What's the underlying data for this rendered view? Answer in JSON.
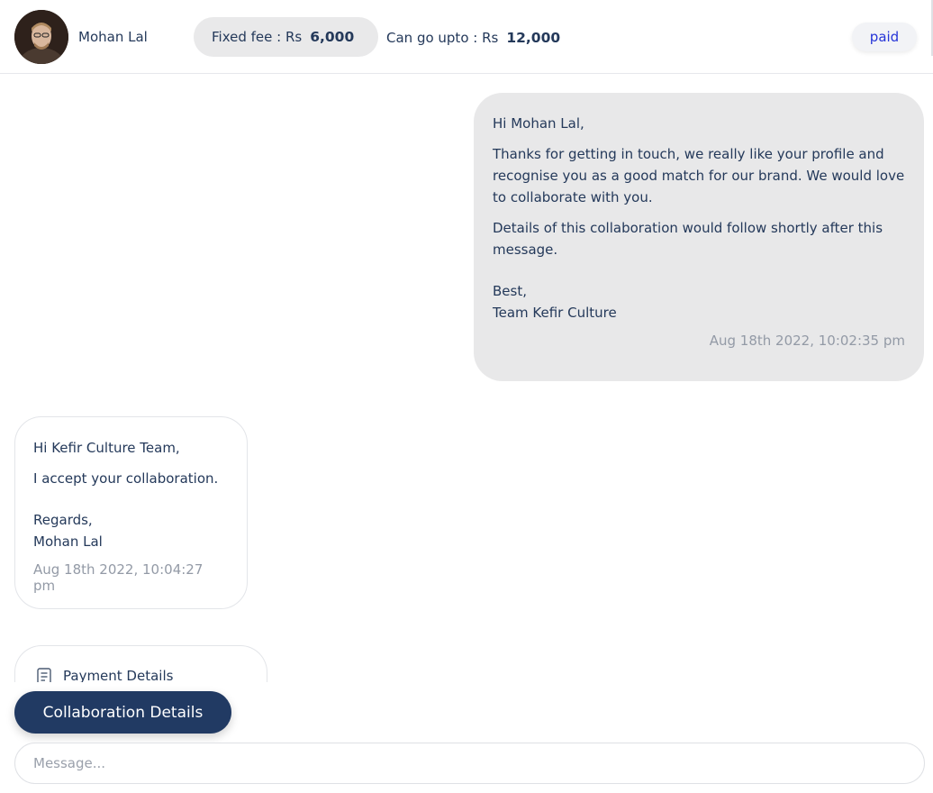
{
  "header": {
    "user_name": "Mohan Lal",
    "fixed_fee_label": "Fixed fee : Rs",
    "fixed_fee_amount": "6,000",
    "upto_label": "Can go upto : Rs",
    "upto_amount": "12,000",
    "status_badge": "paid"
  },
  "messages": [
    {
      "direction": "outgoing",
      "greeting": "Hi Mohan Lal,",
      "paragraphs": [
        "Thanks for getting in touch, we really like your profile and recognise you as a good match for our brand. We would love to collaborate with you.",
        "Details of this collaboration would follow shortly after this message."
      ],
      "signoff": "Best,",
      "signature": "Team Kefir Culture",
      "timestamp": "Aug 18th 2022, 10:02:35 pm"
    },
    {
      "direction": "incoming",
      "greeting": "Hi Kefir Culture Team,",
      "paragraphs": [
        "I accept your collaboration."
      ],
      "signoff": "Regards,",
      "signature": "Mohan Lal",
      "timestamp": "Aug 18th 2022, 10:04:27 pm"
    }
  ],
  "payment_card": {
    "icon": "document-icon",
    "label": "Payment Details"
  },
  "collab_button": "Collaboration Details",
  "composer": {
    "placeholder": "Message..."
  },
  "colors": {
    "primary_navy": "#213a63",
    "text": "#24395a",
    "badge_text": "#2534d8",
    "bubble_out": "#e8e8e9",
    "timestamp": "#939aa6"
  }
}
